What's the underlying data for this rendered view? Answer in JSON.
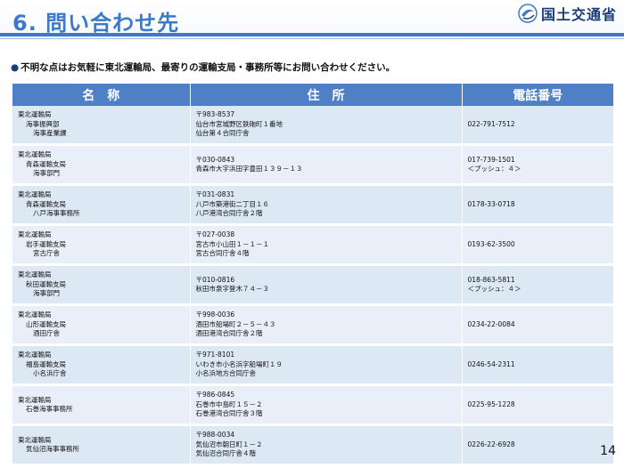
{
  "header": {
    "title": "6. 問い合わせ先",
    "logo_text": "国土交通省"
  },
  "intro": {
    "bullet": "●",
    "text": "不明な点はお気軽に東北運輸局、最寄りの運輸支局・事務所等にお問い合わせください。"
  },
  "table": {
    "headers": [
      "名　称",
      "住　所",
      "電話番号"
    ],
    "rows": [
      {
        "name": [
          "東北運輸局",
          "海事振興部",
          "海事産業課"
        ],
        "address": [
          "〒983-8537",
          "仙台市宮城野区鉄砲町１番地",
          "仙台第４合同庁舎"
        ],
        "phone": [
          "022-791-7512"
        ]
      },
      {
        "name": [
          "東北運輸局",
          "青森運輸支局",
          "海事部門"
        ],
        "address": [
          "〒030-0843",
          "青森市大字浜田字豊田１３９－１３"
        ],
        "phone": [
          "017-739-1501",
          "＜プッシュ：４＞"
        ]
      },
      {
        "name": [
          "東北運輸局",
          "青森運輸支局",
          "八戸海事事務所"
        ],
        "address": [
          "〒031-0831",
          "八戸市築港街二丁目１６",
          "八戸港湾合同庁舎２階"
        ],
        "phone": [
          "0178-33-0718"
        ]
      },
      {
        "name": [
          "東北運輸局",
          "岩手運輸支局",
          "宮古庁舎"
        ],
        "address": [
          "〒027-0038",
          "宮古市小山田１－１－１",
          "宮古合同庁舎４階"
        ],
        "phone": [
          "0193-62-3500"
        ]
      },
      {
        "name": [
          "東北運輸局",
          "秋田運輸支局",
          "海事部門"
        ],
        "address": [
          "〒010-0816",
          "秋田市泉字登木７４－３"
        ],
        "phone": [
          "018-863-5811",
          "＜プッシュ：４＞"
        ]
      },
      {
        "name": [
          "東北運輸局",
          "山形運輸支局",
          "酒田庁舎"
        ],
        "address": [
          "〒998-0036",
          "酒田市船場町２－５－４３",
          "酒田港湾合同庁舎２階"
        ],
        "phone": [
          "0234-22-0084"
        ]
      },
      {
        "name": [
          "東北運輸局",
          "福島運輸支局",
          "小名浜庁舎"
        ],
        "address": [
          "〒971-8101",
          "いわき市小名浜字船場町１９",
          "小名浜地方合同庁舎"
        ],
        "phone": [
          "0246-54-2311"
        ]
      },
      {
        "name": [
          "東北運輸局",
          "石巻海事事務所"
        ],
        "address": [
          "〒986-0845",
          "石巻市中島町１５－２",
          "石巻港湾合同庁舎３階"
        ],
        "phone": [
          "0225-95-1228"
        ]
      },
      {
        "name": [
          "東北運輸局",
          "気仙沼海事事務所"
        ],
        "address": [
          "〒988-0034",
          "気仙沼市朝日町１－２",
          "気仙沼合同庁舎４階"
        ],
        "phone": [
          "0226-22-6928"
        ]
      }
    ]
  },
  "page_number": "14"
}
